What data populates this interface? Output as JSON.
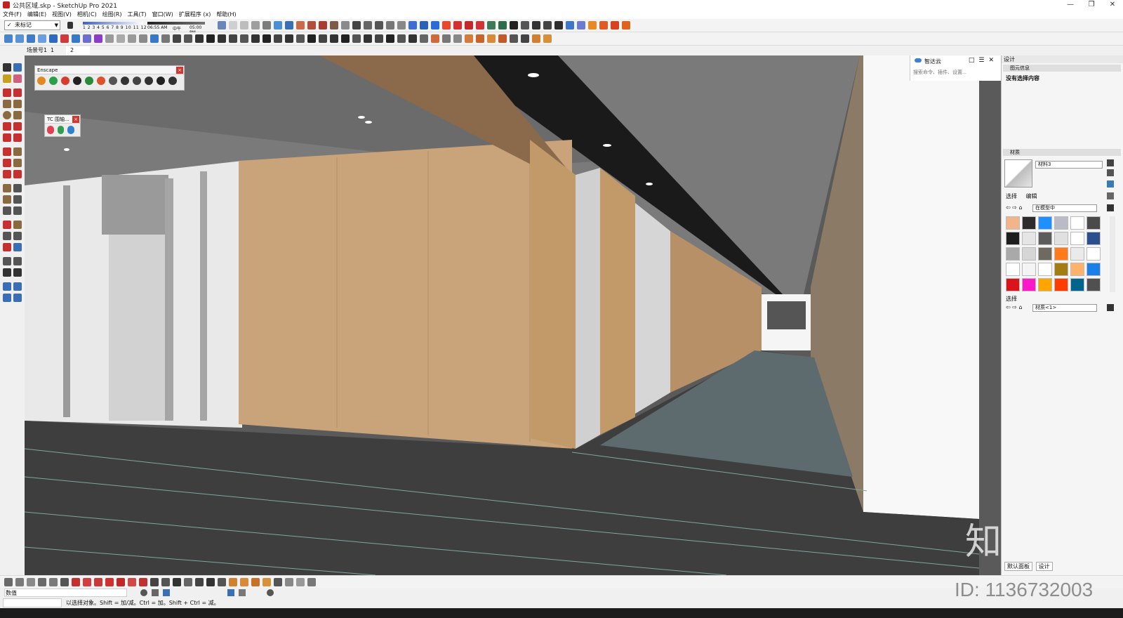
{
  "window": {
    "title": "公共区域.skp - SketchUp Pro 2021",
    "controls": [
      "—",
      "❐",
      "✕"
    ]
  },
  "menu": [
    "文件(F)",
    "编辑(E)",
    "视图(V)",
    "相机(C)",
    "绘图(R)",
    "工具(T)",
    "窗口(W)",
    "扩展程序 (x)",
    "帮助(H)"
  ],
  "toolbar": {
    "tag_select": "未标记",
    "shadow": {
      "months": "1 2 3 4 5 6 7 8 9 10 11 12",
      "time_start": "06:55 AM",
      "time_mid": "中午",
      "time_end": "05:00 PM"
    }
  },
  "scenes": {
    "label": "场景号1",
    "tabs": [
      "1",
      "2"
    ]
  },
  "enscape": {
    "title": "Enscape"
  },
  "tc_window": {
    "title": "TC 围轴..."
  },
  "zhidayun": {
    "title": "智达云",
    "search_placeholder": "搜索命令、插件、设置..."
  },
  "panel": {
    "header": "设计",
    "entity_section": "图元信息",
    "no_selection": "没有选择内容",
    "materials_section": "材质",
    "material_name": "材料3",
    "tab_select": "选择",
    "tab_edit": "编辑",
    "in_model": "在模型中",
    "select_label": "选择",
    "material_dropdown": "材质<1>",
    "bottom_tab1": "默认面板",
    "bottom_tab2": "设计",
    "swatch_colors": [
      "#f2b48a",
      "#2d2b2b",
      "#1e90ff",
      "#b9bcc6",
      "#ffffff",
      "#4a4a4a",
      "#1e1e1e",
      "#e5e5e5",
      "#5c5c5c",
      "#e0e0e0",
      "#ffffff",
      "#2a4f8c",
      "#a9a9a9",
      "#d6d6d6",
      "#6e6a60",
      "#ff7a1a",
      "#eaeaea",
      "#ffffff",
      "#ffffff",
      "#f4f4f4",
      "#ffffff",
      "#a37c12",
      "#ffb26b",
      "#1a7fe8",
      "#d9141b",
      "#ff18c8",
      "#ffa500",
      "#ff3c00",
      "#00648c",
      "#505050"
    ]
  },
  "value_label": "数值",
  "status_message": "以选择对象。Shift = 加/减。Ctrl = 加。Shift + Ctrl = 减。",
  "watermark": {
    "logo_text": "知末",
    "id_text": "ID: 1136732003"
  },
  "accent": "#d9342b"
}
